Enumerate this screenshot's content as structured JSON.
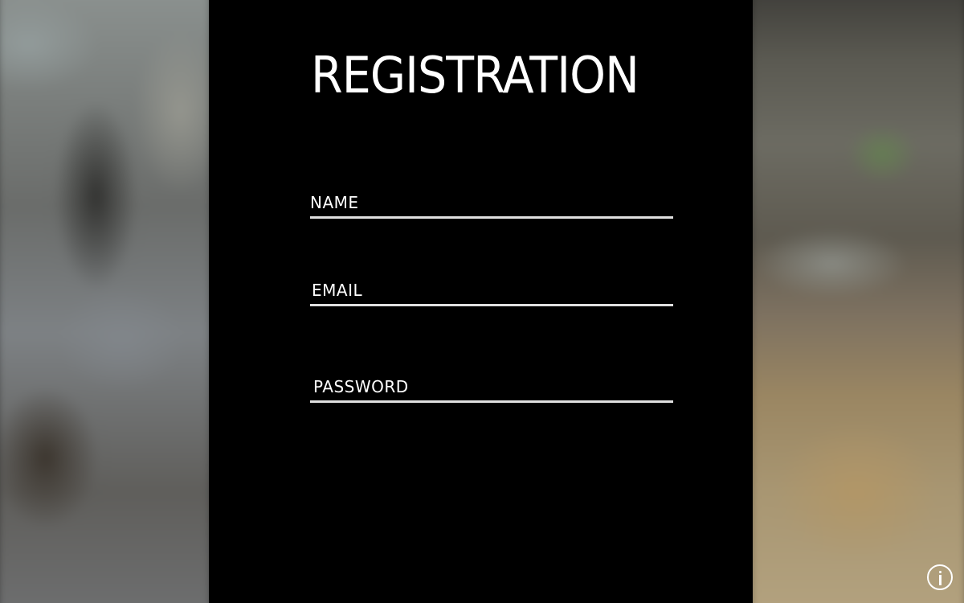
{
  "form": {
    "title": "REGISTRATION",
    "fields": [
      {
        "label": "NAME",
        "value": ""
      },
      {
        "label": "EMAIL",
        "value": ""
      },
      {
        "label": "PASSWORD",
        "value": ""
      }
    ]
  },
  "info_button": {
    "icon": "info-icon"
  },
  "colors": {
    "panel_background": "#000000",
    "text": "#ffffff",
    "underline": "#e0e0e0"
  }
}
